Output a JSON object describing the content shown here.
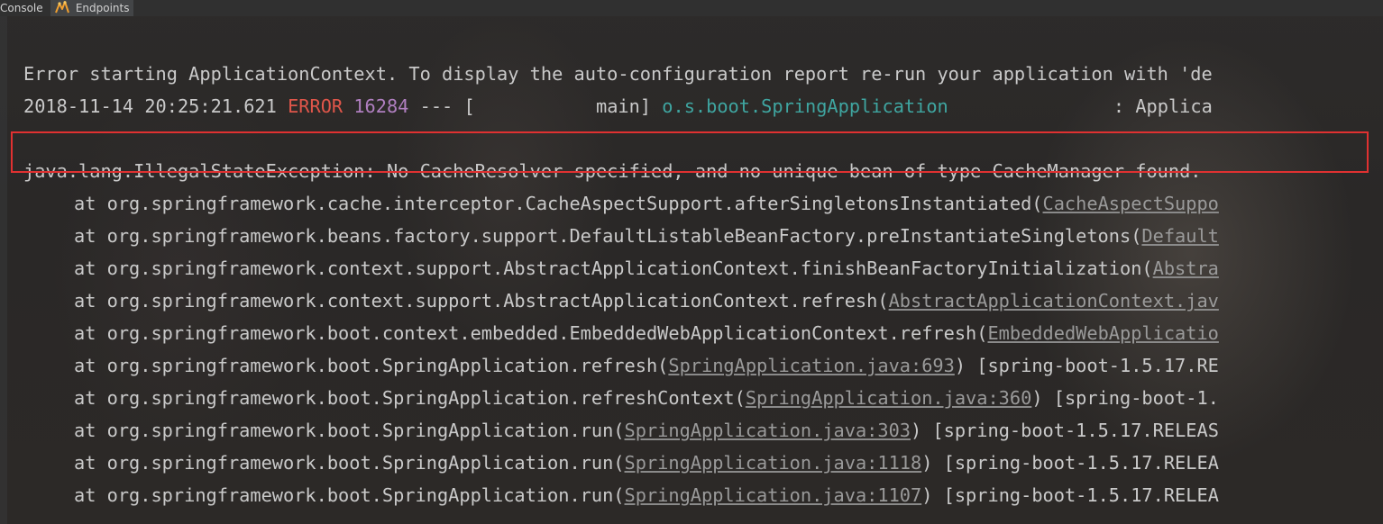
{
  "tabs": [
    {
      "label": "Console"
    },
    {
      "label": "Endpoints"
    }
  ],
  "colors": {
    "error": "#e0564a",
    "pid": "#b07fc0",
    "logger": "#3fa5a0",
    "highlight_box": "#e03131",
    "text": "#c9c9c9"
  },
  "console": {
    "line1": "Error starting ApplicationContext. To display the auto-configuration report re-run your application with 'de",
    "line2": {
      "timestamp": "2018-11-14 20:25:21.621",
      "level": "ERROR",
      "pid": "16284",
      "separator": "--- [",
      "thread": "           main]",
      "logger": "o.s.boot.SpringApplication",
      "message": "               : Applica"
    },
    "exception": "java.lang.IllegalStateException: No CacheResolver specified, and no unique bean of type CacheManager found.",
    "stack": [
      {
        "at": "at org.springframework.cache.interceptor.CacheAspectSupport.afterSingletonsInstantiated(",
        "link": "CacheAspectSuppo",
        "tail": ""
      },
      {
        "at": "at org.springframework.beans.factory.support.DefaultListableBeanFactory.preInstantiateSingletons(",
        "link": "Default",
        "tail": ""
      },
      {
        "at": "at org.springframework.context.support.AbstractApplicationContext.finishBeanFactoryInitialization(",
        "link": "Abstra",
        "tail": ""
      },
      {
        "at": "at org.springframework.context.support.AbstractApplicationContext.refresh(",
        "link": "AbstractApplicationContext.jav",
        "tail": ""
      },
      {
        "at": "at org.springframework.boot.context.embedded.EmbeddedWebApplicationContext.refresh(",
        "link": "EmbeddedWebApplicatio",
        "tail": ""
      },
      {
        "at": "at org.springframework.boot.SpringApplication.refresh(",
        "link": "SpringApplication.java:693",
        "tail": ") [spring-boot-1.5.17.RE"
      },
      {
        "at": "at org.springframework.boot.SpringApplication.refreshContext(",
        "link": "SpringApplication.java:360",
        "tail": ") [spring-boot-1."
      },
      {
        "at": "at org.springframework.boot.SpringApplication.run(",
        "link": "SpringApplication.java:303",
        "tail": ") [spring-boot-1.5.17.RELEAS"
      },
      {
        "at": "at org.springframework.boot.SpringApplication.run(",
        "link": "SpringApplication.java:1118",
        "tail": ") [spring-boot-1.5.17.RELEA"
      },
      {
        "at": "at org.springframework.boot.SpringApplication.run(",
        "link": "SpringApplication.java:1107",
        "tail": ") [spring-boot-1.5.17.RELEA"
      }
    ]
  }
}
